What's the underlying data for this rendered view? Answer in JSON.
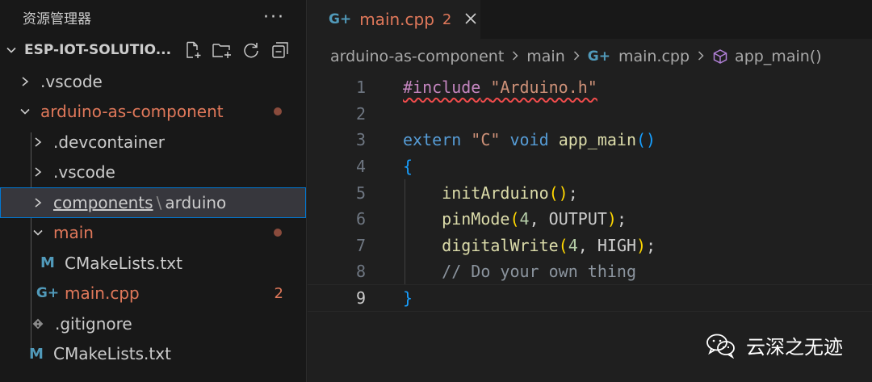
{
  "explorer": {
    "title": "资源管理器",
    "more_icon": "more-dots-icon",
    "project": {
      "name": "ESP-IOT-SOLUTIO...",
      "actions": [
        "new-file-icon",
        "new-folder-icon",
        "refresh-icon",
        "collapse-all-icon"
      ]
    },
    "tree": [
      {
        "label": ".vscode"
      },
      {
        "label": "arduino-as-component"
      },
      {
        "label": ".devcontainer"
      },
      {
        "label": ".vscode"
      },
      {
        "label": "components",
        "sep": "\\",
        "label2": "arduino"
      },
      {
        "label": "main"
      },
      {
        "label": "CMakeLists.txt",
        "icon_text": "M"
      },
      {
        "label": "main.cpp",
        "icon_text": "G+",
        "count": "2"
      },
      {
        "label": ".gitignore"
      },
      {
        "label": "CMakeLists.txt",
        "icon_text": "M"
      }
    ]
  },
  "editor": {
    "tab": {
      "icon_text": "G+",
      "label": "main.cpp",
      "badge": "2"
    },
    "breadcrumb": [
      "arduino-as-component",
      "main",
      "main.cpp",
      "app_main()"
    ],
    "breadcrumb_icon_text": "G+",
    "line_numbers": [
      "1",
      "2",
      "3",
      "4",
      "5",
      "6",
      "7",
      "8",
      "9"
    ],
    "active_line": "9",
    "code": {
      "l1_directive": "#include",
      "l1_space": " ",
      "l1_string": "\"Arduino.h\"",
      "l3_extern": "extern",
      "l3_c": "\"C\"",
      "l3_void": "void",
      "l3_fn": "app_main",
      "l3_parens": "()",
      "l4_brace": "{",
      "l5_fn": "initArduino",
      "l5_parens": "()",
      "l5_semi": ";",
      "l6_fn": "pinMode",
      "l6_open": "(",
      "l6_num": "4",
      "l6_comma": ", ",
      "l6_arg": "OUTPUT",
      "l6_close": ")",
      "l6_semi": ";",
      "l7_fn": "digitalWrite",
      "l7_open": "(",
      "l7_num": "4",
      "l7_comma": ", ",
      "l7_arg": "HIGH",
      "l7_close": ")",
      "l7_semi": ";",
      "l8_comment": "// Do your own thing",
      "l9_brace": "}"
    }
  },
  "watermark": {
    "text": "云深之无迹",
    "icon": "wechat-icon"
  },
  "colors": {
    "accent": "#0078d4",
    "modified": "#e0785a",
    "error_squiggle": "#f14c4c",
    "file_icon_blue": "#519aba"
  }
}
